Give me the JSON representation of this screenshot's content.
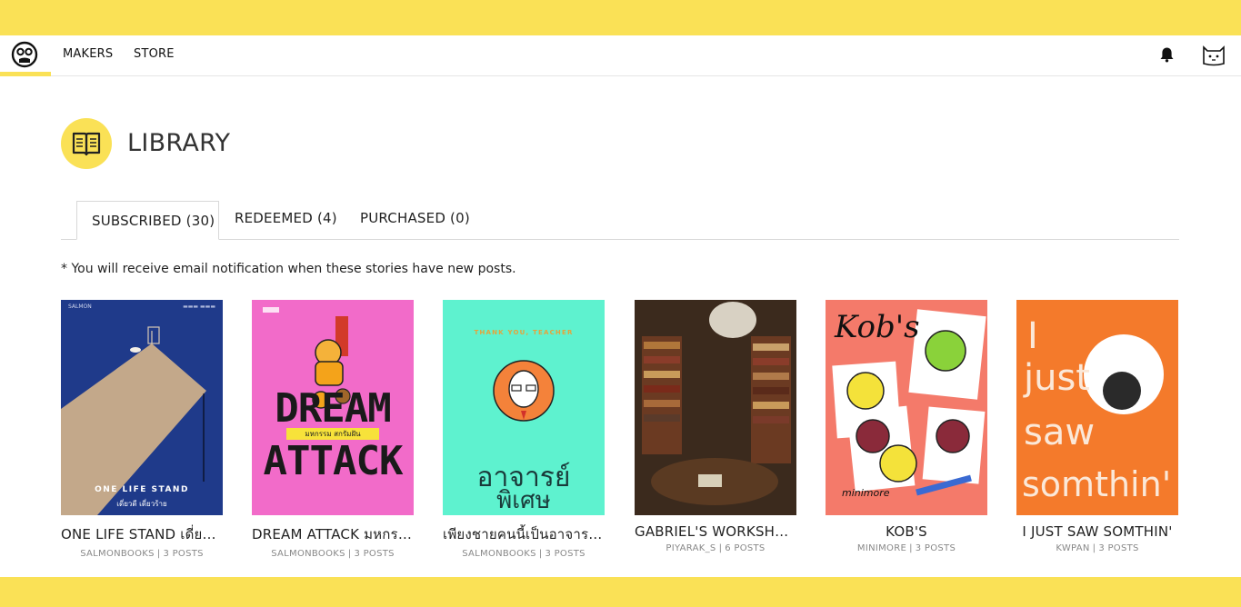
{
  "nav": {
    "makers_label": "MAKERS",
    "store_label": "STORE"
  },
  "header": {
    "title": "LIBRARY"
  },
  "tabs": [
    {
      "label": "SUBSCRIBED",
      "count": "(30)"
    },
    {
      "label": "REDEEMED",
      "count": "(4)"
    },
    {
      "label": "PURCHASED",
      "count": "(0)"
    }
  ],
  "notice": "* You will receive email notification when these stories have new posts.",
  "books": [
    {
      "title": "ONE LIFE STAND เดี่ยวดี เดี่ยวร้าย",
      "author": "SALMONBOOKS",
      "posts": "3 POSTS",
      "cover_text_1": "ONE LIFE STAND",
      "cover_text_2": "เดี่ยวดี เดี่ยวร้าย",
      "cover_text_3": "SALMON"
    },
    {
      "title": "DREAM ATTACK มหกรรมสกรัมฝัน",
      "author": "SALMONBOOKS",
      "posts": "3 POSTS",
      "cover_text_1": "DREAM",
      "cover_text_2": "ATTACK",
      "cover_text_3": "มหกรรม สกรัมฝัน"
    },
    {
      "title": "เพียงชายคนนี้เป็นอาจารย์พิเศษ",
      "author": "SALMONBOOKS",
      "posts": "3 POSTS",
      "cover_text_1": "THANK YOU, TEACHER",
      "cover_text_2": "อาจารย์",
      "cover_text_3": "พิเศษ"
    },
    {
      "title": "GABRIEL'S WORKSHOP ...",
      "author": "PIYARAK_S",
      "posts": "6 POSTS"
    },
    {
      "title": "KOB'S",
      "author": "MINIMORE",
      "posts": "3 POSTS",
      "cover_text_1": "Kob's",
      "cover_text_2": "minimore"
    },
    {
      "title": "I JUST SAW SOMTHIN'",
      "author": "KWPAN",
      "posts": "3 POSTS",
      "cover_text_1": "I",
      "cover_text_2": "just",
      "cover_text_3": "saw",
      "cover_text_4": "somthin'"
    }
  ],
  "colors": {
    "brand_yellow": "#fae156",
    "cover_navy": "#1f3a8a",
    "cover_pink": "#f26bc9",
    "cover_mint": "#5ef2cf",
    "cover_salmon": "#f47a6a",
    "cover_orange": "#f47a2b"
  }
}
